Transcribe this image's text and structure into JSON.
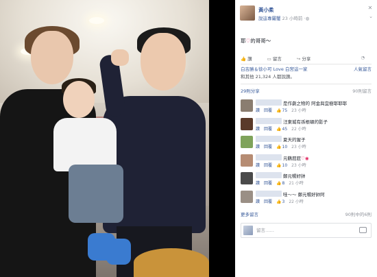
{
  "post": {
    "author": "黃小柔",
    "sub_tag": "說這專屬蟹",
    "time": "23 小時前",
    "caption_prefix": "耶",
    "caption_suffix": "的哥哥～",
    "actions": {
      "like": "讚",
      "comment": "留言",
      "share": "分享"
    },
    "likes_names": "白吉勝＆徐小可 Love 白宮這一家",
    "likes_count": "和其他 21,324 人都說讚。",
    "popular_label": "人氣留言",
    "shares": "29則分享",
    "comments_total": "90則留言"
  },
  "comments": [
    {
      "text": "是作劇之物的 阿金與宜樹耶耶耶",
      "likes": "75",
      "time": "23 小時",
      "avatar_color": "#8a7d70"
    },
    {
      "text": "汪東城有孫根碩的影子",
      "likes": "45",
      "time": "22 小時",
      "avatar_color": "#5a3a2a"
    },
    {
      "text": "夏天的猩子",
      "likes": "10",
      "time": "23 小時",
      "avatar_color": "#7fa35a"
    },
    {
      "text": "元鶴屁屁",
      "likes": "10",
      "time": "23 小時",
      "avatar_color": "#b68c73",
      "has_heart": true
    },
    {
      "text": "鄭元暢好帥",
      "likes": "8",
      "time": "21 小時",
      "avatar_color": "#4a4a4a"
    },
    {
      "text": "哇～～ 鄭元暢好帥阿",
      "likes": "3",
      "time": "22 小時",
      "avatar_color": "#9a8f85"
    }
  ],
  "more_comments": "更多留言",
  "more_comments_count": "90則中的6則",
  "input": {
    "placeholder": "留言……"
  }
}
